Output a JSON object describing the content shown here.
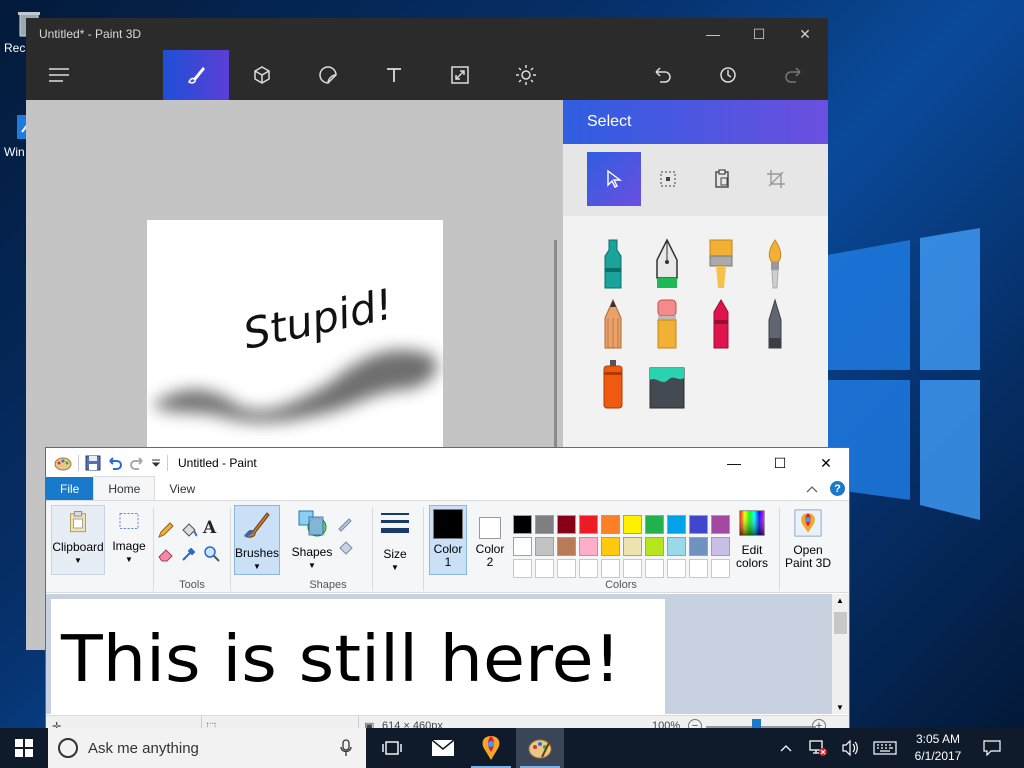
{
  "desktop": {
    "icons": [
      {
        "label": "Rec"
      },
      {
        "label": "Win Up"
      }
    ]
  },
  "paint3d": {
    "title": "Untitled* - Paint 3D",
    "toolbar": [
      "menu-icon",
      "brush-icon",
      "3d-cube-icon",
      "sticker-icon",
      "text-icon",
      "canvas-resize-icon",
      "effects-icon",
      "undo-icon",
      "history-icon",
      "redo-icon"
    ],
    "active_tool": "brush-icon",
    "canvas_text": "Stupid!",
    "panel": {
      "title": "Select",
      "select_tools": [
        "cursor-icon",
        "select-region-icon",
        "paste-icon",
        "crop-icon"
      ],
      "brushes": [
        "marker",
        "calligraphy-pen",
        "oil-brush",
        "watercolor",
        "pencil",
        "eraser",
        "crayon",
        "pixel-pen",
        "spray-can",
        "fill-bucket"
      ],
      "brush_colors": {
        "marker": "#1aa39a",
        "calligraphy-pen": "#1db954",
        "oil-brush": "#f2b134",
        "watercolor": "#f2b134",
        "pencil": "#e8a26a",
        "eraser": "#f48a8a",
        "crayon": "#e0144c",
        "pixel-pen": "#5f6670",
        "spray-can": "#f05a10",
        "fill-bucket": "#2ad3b0"
      }
    }
  },
  "paint": {
    "title": "Untitled - Paint",
    "tabs": [
      {
        "label": "File"
      },
      {
        "label": "Home"
      },
      {
        "label": "View"
      }
    ],
    "groups": {
      "clipboard": "Clipboard",
      "image": "Image",
      "tools": "Tools",
      "brushes": "Brushes",
      "shapes": "Shapes",
      "shapes_group": "Shapes",
      "size": "Size",
      "color1_line1": "Color",
      "color1_line2": "1",
      "color2_line1": "Color",
      "color2_line2": "2",
      "colors_group": "Colors",
      "edit_colors_line1": "Edit",
      "edit_colors_line2": "colors",
      "open3d_line1": "Open",
      "open3d_line2": "Paint 3D"
    },
    "palette_row1": [
      "#000000",
      "#7f7f7f",
      "#880015",
      "#ed1c24",
      "#ff7f27",
      "#fff200",
      "#22b14c",
      "#00a2e8",
      "#3f48cc",
      "#a349a4"
    ],
    "palette_row2": [
      "#ffffff",
      "#c3c3c3",
      "#b97a57",
      "#ffaec9",
      "#ffc90e",
      "#efe4b0",
      "#b5e61d",
      "#99d9ea",
      "#7092be",
      "#c8bfe7"
    ],
    "color1": "#000000",
    "color2": "#ffffff",
    "canvas_text": "This is still here!",
    "status": {
      "dimensions": "614 × 460px",
      "zoom": "100%"
    }
  },
  "taskbar": {
    "search_placeholder": "Ask me anything",
    "time": "3:05 AM",
    "date": "6/1/2017"
  }
}
